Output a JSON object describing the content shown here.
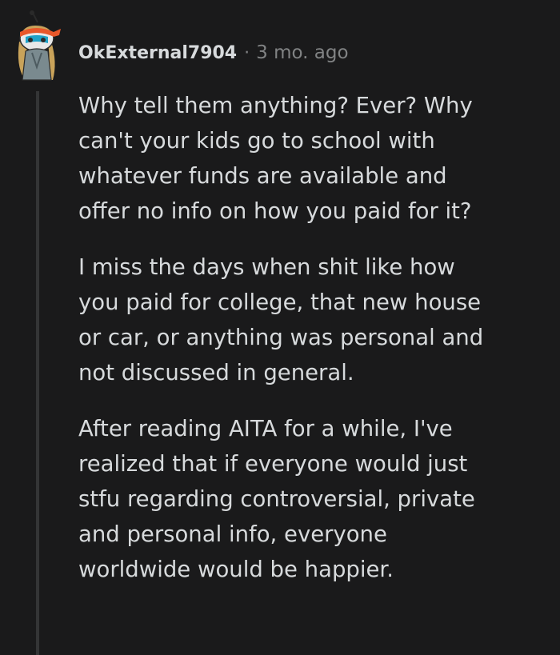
{
  "comment": {
    "username": "OkExternal7904",
    "separator": "·",
    "timestamp": "3 mo. ago",
    "paragraphs": [
      {
        "lines": [
          "Why tell them anything? Ever? Why",
          "can't your kids go to school with",
          "whatever funds are available and",
          "offer no info on how you paid for it?"
        ]
      },
      {
        "lines": [
          "I miss the days when shit like how",
          "you paid for college, that new house",
          "or car, or anything was personal and",
          "not discussed in general."
        ]
      },
      {
        "lines": [
          "After reading AITA for a while, I've",
          "realized that if everyone would just",
          "stfu regarding controversial, private",
          "and personal info, everyone",
          "worldwide would be happier."
        ]
      }
    ]
  },
  "colors": {
    "background": "#1a1a1b",
    "text": "#d7dadc",
    "meta": "#818384",
    "thread_line": "#343536",
    "avatar_headband": "#e8572a",
    "avatar_face": "#1fa2c8"
  },
  "icons": {
    "avatar": "snoo-avatar-icon"
  }
}
